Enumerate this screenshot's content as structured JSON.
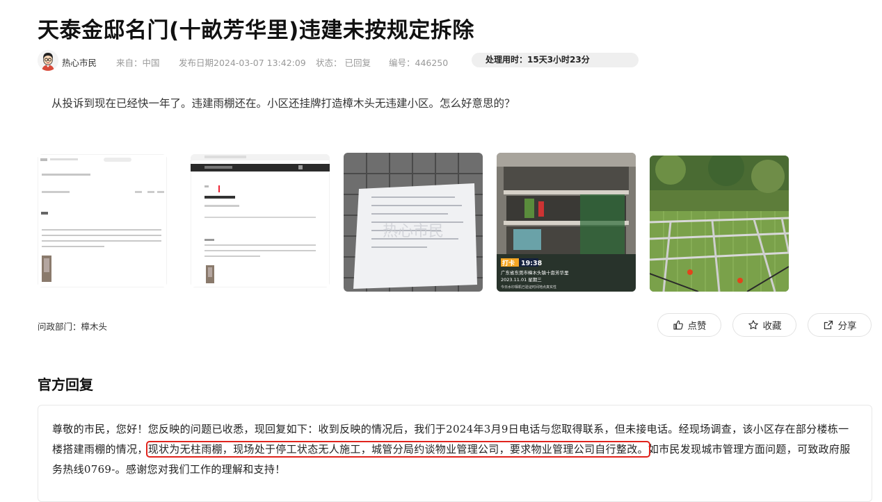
{
  "post": {
    "title": "天泰金邸名门(十畝芳华里)违建未按规定拆除",
    "username": "热心市民",
    "source": "来自：中国",
    "publish_date": "发布日期2024-03-07 13:42:09",
    "status": "状态： 已回复",
    "number": "编号：446250",
    "duration": "处理用时：15天3小时23分",
    "content": "从投诉到现在已经快一年了。违建雨棚还在。小区还挂牌打造樟木头无违建小区。怎么好意思的？",
    "department": "问政部门：樟木头",
    "watermark": "热心市民",
    "photo_caption": {
      "punch_tag": "打卡",
      "time": "19:38",
      "location": "广东省东莞市樟木头镇十亩芳华里",
      "date": "2023.11.01 星期三",
      "footer": "今日水印相机已验证时间地点真实性"
    }
  },
  "actions": {
    "like": "点赞",
    "favorite": "收藏",
    "share": "分享"
  },
  "reply": {
    "section_title": "官方回复",
    "text_before": "尊敬的市民，您好！您反映的问题已收悉，现回复如下：收到反映的情况后，我们于2024年3月9日电话与您取得联系，但未接电话。经现场调查，该小区存在部分楼栋一楼搭建雨棚的情况，",
    "text_highlight": "现状为无柱雨棚，现场处于停工状态无人施工，城管分局约谈物业管理公司，要求物业管理公司自行整改。",
    "text_after": "如市民发现城市管理方面问题，可致政府服务热线0769-。感谢您对我们工作的理解和支持！"
  }
}
